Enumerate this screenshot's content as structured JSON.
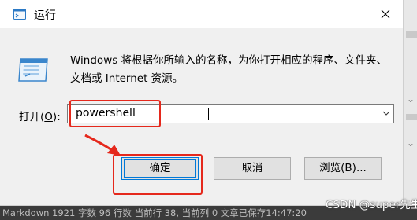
{
  "dialog": {
    "title": "运行",
    "description": "Windows 将根据你所输入的名称，为你打开相应的程序、文件夹、文档或 Internet 资源。",
    "open_label_prefix": "打开(",
    "open_label_hotkey": "O",
    "open_label_suffix": "):",
    "open_value": "powershell",
    "ok_label": "确定",
    "cancel_label": "取消",
    "browse_label": "浏览(B)..."
  },
  "background": {
    "status_text": "Markdown  1921 字数  96 行数  当前行 38, 当前列 0  文章已保存14:47:20"
  },
  "watermark": "CSDN @super先生",
  "colors": {
    "highlight": "#e5281c",
    "accent": "#0078d7"
  }
}
